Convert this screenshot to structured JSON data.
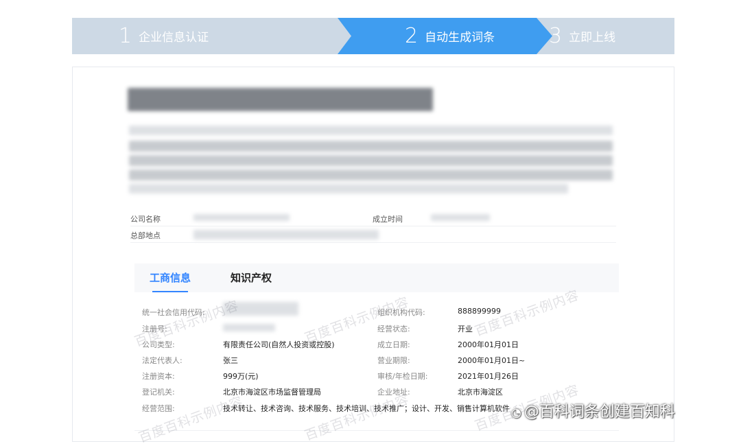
{
  "steps": [
    {
      "num": "1",
      "label": "企业信息认证"
    },
    {
      "num": "2",
      "label": "自动生成词条"
    },
    {
      "num": "3",
      "label": "立即上线"
    }
  ],
  "company_meta": {
    "name_label": "公司名称",
    "founded_label": "成立时间",
    "hq_label": "总部地点"
  },
  "tabs": [
    {
      "label": "工商信息",
      "active": true
    },
    {
      "label": "知识产权",
      "active": false
    }
  ],
  "business_info": {
    "left": [
      {
        "label": "统一社会信用代码:",
        "value": ""
      },
      {
        "label": "注册号:",
        "value": ""
      },
      {
        "label": "公司类型:",
        "value": "有限责任公司(自然人投资或控股)"
      },
      {
        "label": "法定代表人:",
        "value": "张三"
      },
      {
        "label": "注册资本:",
        "value": "999万(元)"
      },
      {
        "label": "登记机关:",
        "value": "北京市海淀区市场监督管理局"
      },
      {
        "label": "经营范围:",
        "value": "技术转让、技术咨询、技术服务、技术培训、技术推广；设计、开发、销售计算机软件"
      }
    ],
    "right": [
      {
        "label": "组织机构代码:",
        "value": "888899999"
      },
      {
        "label": "经营状态:",
        "value": "开业"
      },
      {
        "label": "成立日期:",
        "value": "2000年01月01日"
      },
      {
        "label": "营业期限:",
        "value": "2000年01月01日~"
      },
      {
        "label": "审核/年检日期:",
        "value": "2021年01月26日"
      },
      {
        "label": "企业地址:",
        "value": "北京市海淀区"
      }
    ]
  },
  "watermark_text": "百度百科示例内容",
  "corner_mark": {
    "icon": "weibo-icon",
    "text": "@百科词条创建百知科"
  },
  "colors": {
    "step_bg": "#cdd9e5",
    "step_active": "#3f9df0",
    "tab_active": "#3385ff"
  }
}
